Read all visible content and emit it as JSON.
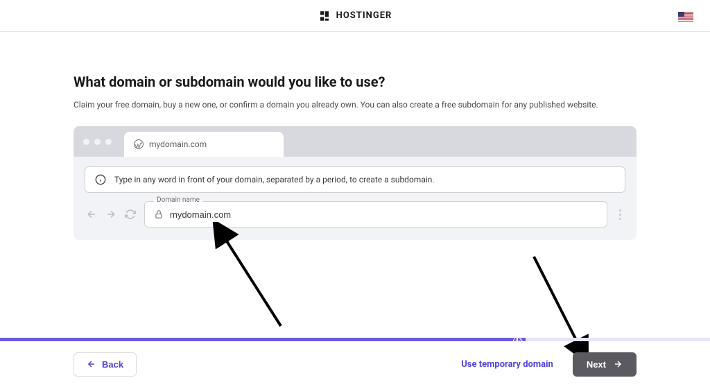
{
  "header": {
    "brand": "HOSTINGER"
  },
  "page": {
    "title": "What domain or subdomain would you like to use?",
    "subtitle": "Claim your free domain, buy a new one, or confirm a domain you already own. You can also create a free subdomain for any published website."
  },
  "browser": {
    "tab_label": "mydomain.com",
    "info_text": "Type in any word in front of your domain, separated by a period, to create a subdomain.",
    "input_label": "Domain name",
    "input_value": "mydomain.com"
  },
  "progress": {
    "percent": 74,
    "label": "74%"
  },
  "footer": {
    "back_label": "Back",
    "temp_domain_label": "Use temporary domain",
    "next_label": "Next"
  }
}
